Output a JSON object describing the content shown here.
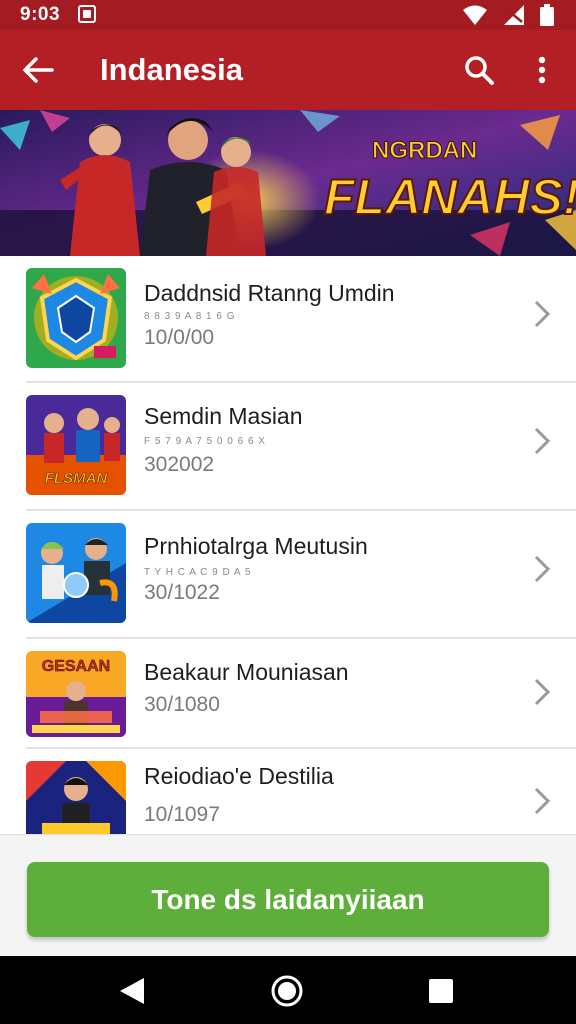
{
  "status_bar": {
    "time": "9:03",
    "icons": [
      "notification-icon",
      "wifi-icon",
      "signal-icon",
      "battery-icon"
    ]
  },
  "app_bar": {
    "title": "Indanesia",
    "background": "#b41e25",
    "icons": [
      "back-arrow-icon",
      "search-icon",
      "more-vert-icon"
    ]
  },
  "banner": {
    "line1": "NGRDAN",
    "line2": "FLANAHS!"
  },
  "list": {
    "items": [
      {
        "title": "Daddnsid Rtanng Umdin",
        "subtitle": "8 8 3 9 A 8 1 6 G",
        "value": "10/0/00",
        "thumb_label": ""
      },
      {
        "title": "Semdin Masian",
        "subtitle": "F 5 7 9 A 7 5 0 0 6 6 X",
        "value": "302002",
        "thumb_label": "FLSMAN"
      },
      {
        "title": "Prnhiotalrga Meutusin",
        "subtitle": "T Y H C A C 9 D A 5",
        "value": "30/1022",
        "thumb_label": ""
      },
      {
        "title": "Beakaur Mouniasan",
        "subtitle": "",
        "value": "30/1080",
        "thumb_label": "GESAAN"
      },
      {
        "title": "Reiodiao'e Destilia",
        "subtitle": "",
        "value": "10/1097",
        "thumb_label": ""
      }
    ]
  },
  "cta": {
    "label": "Tone ds laidanyiiaan",
    "color": "#5dae3a"
  },
  "nav_bar": {
    "icons": [
      "nav-back-icon",
      "nav-home-icon",
      "nav-recent-icon"
    ]
  }
}
